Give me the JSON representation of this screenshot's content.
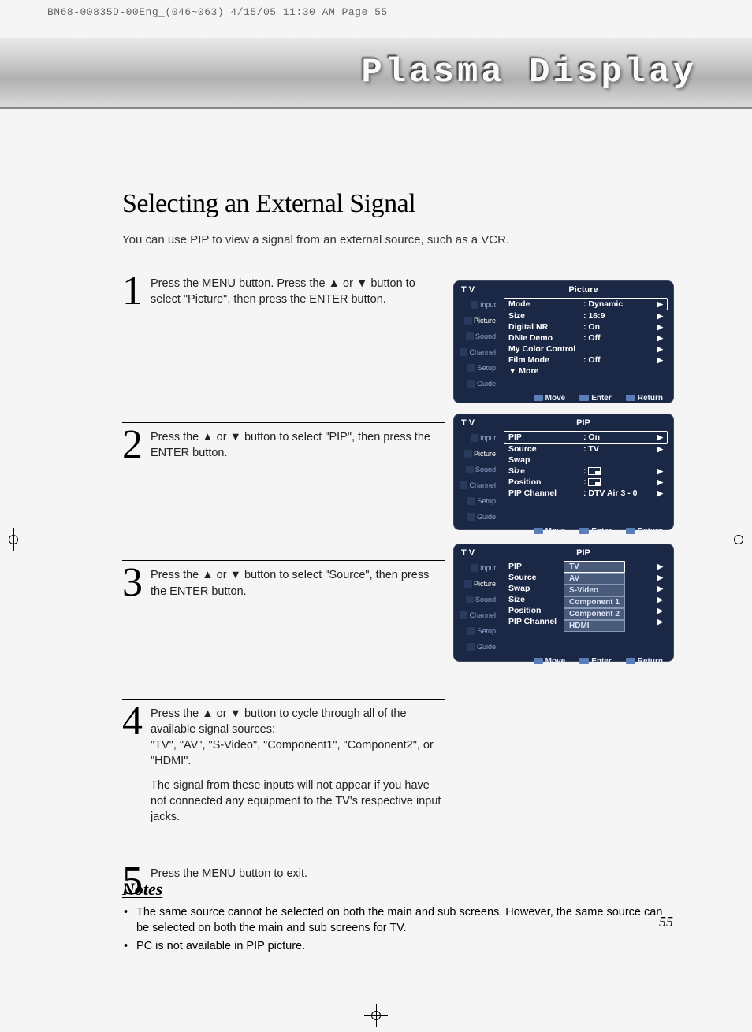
{
  "file_header": "BN68-00835D-00Eng_(046~063)  4/15/05  11:30 AM  Page 55",
  "banner_title": "Plasma Display",
  "heading": "Selecting an External Signal",
  "intro": "You can use PIP to view a signal from an external source, such as a VCR.",
  "steps": [
    {
      "num": "1",
      "text": "Press the MENU button. Press the ▲ or ▼ button to select \"Picture\", then press the ENTER button."
    },
    {
      "num": "2",
      "text": "Press the ▲ or ▼ button to select \"PIP\", then press the ENTER button."
    },
    {
      "num": "3",
      "text": "Press the ▲ or ▼ button to select \"Source\", then press the ENTER button."
    },
    {
      "num": "4",
      "text1": "Press the ▲ or ▼ button to cycle through all of the available signal sources:",
      "text2": "\"TV\", \"AV\", \"S-Video\", \"Component1\", \"Component2\", or \"HDMI\".",
      "text3": "The signal from these inputs will not appear if you have not connected any equipment to the TV's respective input jacks."
    },
    {
      "num": "5",
      "text": "Press the MENU button to exit."
    }
  ],
  "osd": {
    "sidebar": [
      "Input",
      "Picture",
      "Sound",
      "Channel",
      "Setup",
      "Guide"
    ],
    "footer": {
      "move": "Move",
      "enter": "Enter",
      "return": "Return"
    }
  },
  "osd1": {
    "left": "T V",
    "title": "Picture",
    "rows": [
      {
        "label": "Mode",
        "value": ": Dynamic",
        "boxed": true
      },
      {
        "label": "Size",
        "value": ": 16:9"
      },
      {
        "label": "Digital NR",
        "value": ": On"
      },
      {
        "label": "DNIe Demo",
        "value": ": Off"
      },
      {
        "label": "My Color Control",
        "value": ""
      },
      {
        "label": "Film Mode",
        "value": ": Off"
      },
      {
        "label": "▼ More",
        "value": "",
        "noarrow": true
      }
    ]
  },
  "osd2": {
    "left": "T V",
    "title": "PIP",
    "rows": [
      {
        "label": "PIP",
        "value": ": On",
        "boxed": true
      },
      {
        "label": "Source",
        "value": ": TV"
      },
      {
        "label": "Swap",
        "value": "",
        "noarrow": true
      },
      {
        "label": "Size",
        "value": ":",
        "posicon": true
      },
      {
        "label": "Position",
        "value": ":",
        "posicon": true
      },
      {
        "label": "PIP Channel",
        "value": ": DTV Air 3 - 0"
      }
    ]
  },
  "osd3": {
    "left": "T V",
    "title": "PIP",
    "rows": [
      {
        "label": "PIP",
        "value": ":"
      },
      {
        "label": "Source",
        "value": ":"
      },
      {
        "label": "Swap",
        "value": ""
      },
      {
        "label": "Size",
        "value": ":"
      },
      {
        "label": "Position",
        "value": ":"
      },
      {
        "label": "PIP Channel",
        "value": ":"
      }
    ],
    "dropdown": [
      "TV",
      "AV",
      "S-Video",
      "Component 1",
      "Component 2",
      "HDMI"
    ]
  },
  "notes": {
    "heading": "Notes",
    "items": [
      "The same source cannot be selected on both the main and sub screens. However, the same source can be selected on both the main and sub screens for TV.",
      "PC is not available in PIP picture."
    ]
  },
  "page_num": "55"
}
